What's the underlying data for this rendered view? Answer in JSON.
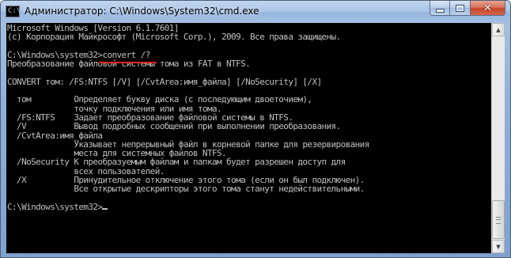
{
  "window": {
    "title": "Администратор: C:\\Windows\\System32\\cmd.exe",
    "icon": "cmd-window-icon",
    "icon_glyph": "C:\\",
    "buttons": {
      "minimize": "minimize-icon",
      "maximize": "maximize-icon",
      "close": "close-icon",
      "close_glyph": "✕"
    }
  },
  "console": {
    "lines": [
      "Microsoft Windows [Version 6.1.7601]",
      "(c) Корпорация Майкрософт (Microsoft Corp.), 2009. Все права защищены.",
      "",
      "C:\\Windows\\system32>convert /?",
      "Преобразование файловой системы тома из FAT в NTFS.",
      "",
      "CONVERT том: /FS:NTFS [/V] [/CvtArea:имя_файла] [/NoSecurity] [/X]",
      "",
      "  том         Определяет букву диска (с последующим двоеточием),",
      "              точку подключения или имя тома.",
      "  /FS:NTFS    Задает преобразование файловой системы в NTFS.",
      "  /V          Вывод подробных сообщений при выполнении преобразования.",
      "  /CvtArea:имя_файла",
      "              Указывает непрерывный файл в корневой папке для резервирования",
      "              места для системных файлов NTFS.",
      "  /NoSecurity К преобразуемым файлам и папкам будет разрешен доступ для",
      "              всех пользователей.",
      "  /X          Принудительное отключение этого тома (если он был подключен).",
      "              Все открытые дескрипторы этого тома станут недействительными.",
      "",
      "C:\\Windows\\system32>"
    ],
    "highlighted_command": "convert /?",
    "prompt": "C:\\Windows\\system32>",
    "colors": {
      "background": "#000000",
      "text": "#c0c0c0",
      "highlight_underline": "#e0241b"
    }
  },
  "scrollbar": {
    "up_glyph": "▲",
    "down_glyph": "▼"
  }
}
